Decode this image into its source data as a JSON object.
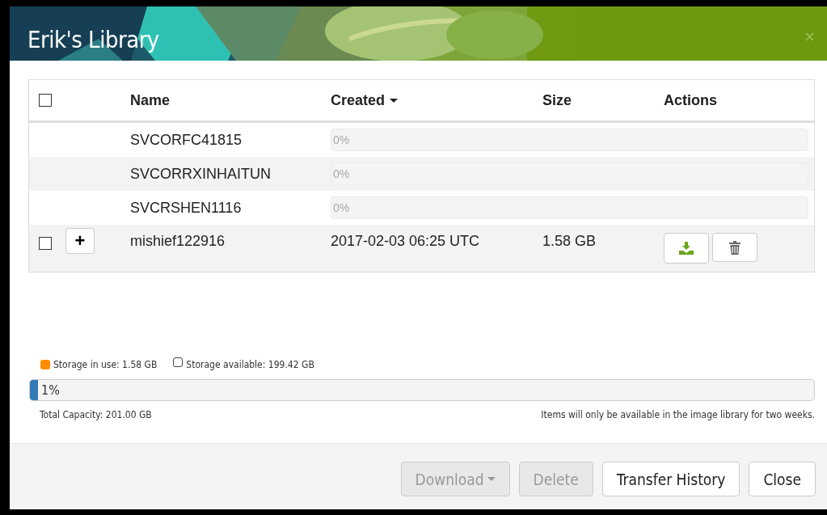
{
  "dialog": {
    "title": "Erik's Library",
    "close": "×"
  },
  "table": {
    "select_all": {
      "checked": false
    },
    "columns": [
      {
        "label": "Name",
        "sorted": false
      },
      {
        "label": "Created",
        "sorted": true
      },
      {
        "label": "Size",
        "sorted": false
      },
      {
        "label": "Actions",
        "sorted": false
      }
    ],
    "rows": [
      {
        "kind": "upload",
        "name": "SVCORFC41815",
        "progress": "0%",
        "level": 0
      },
      {
        "kind": "upload",
        "name": "SVCORRXINHAITUN",
        "progress": "0%",
        "level": 0
      },
      {
        "kind": "upload",
        "name": "SVCRSHEN1116",
        "progress": "0%",
        "level": 0
      },
      {
        "kind": "item",
        "checked": false,
        "expand": "+",
        "name": "mishief122916",
        "created": "2017-02-03 06:25 UTC",
        "size": "1.58 GB"
      }
    ]
  },
  "storage": {
    "legend": [
      {
        "kind": "used",
        "label": "Storage in use: 1.58 GB",
        "color": "#ff8c00"
      },
      {
        "kind": "available",
        "label": "Storage available: 199.42 GB"
      }
    ],
    "level": 0.01,
    "reading": "1%",
    "capacity": "Total Capacity: 201.00 GB",
    "note": "Items will only be available in the image library for two weeks."
  },
  "buttons": [
    {
      "label": "Download",
      "menu": true,
      "disabled": true
    },
    {
      "label": "Delete",
      "menu": false,
      "disabled": true
    },
    {
      "label": "Transfer History",
      "menu": false,
      "disabled": false
    },
    {
      "label": "Close",
      "menu": false,
      "disabled": false
    }
  ]
}
